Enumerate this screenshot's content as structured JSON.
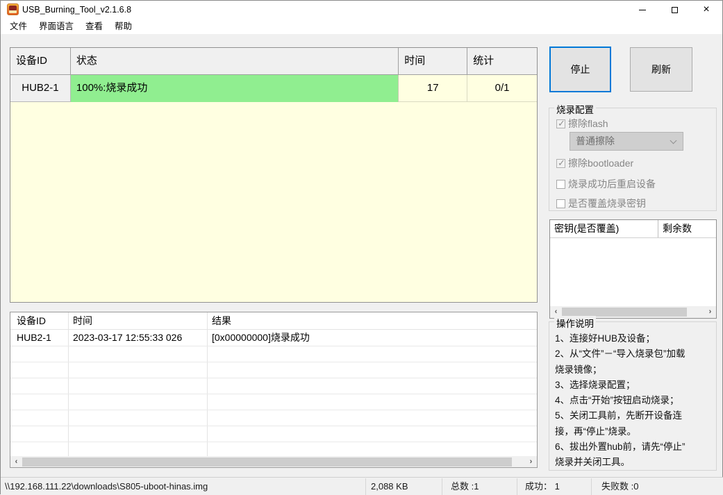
{
  "window": {
    "title": "USB_Burning_Tool_v2.1.6.8"
  },
  "menu": {
    "items": [
      "文件",
      "界面语言",
      "查看",
      "帮助"
    ]
  },
  "device_table": {
    "headers": {
      "id": "设备ID",
      "status": "状态",
      "time": "时间",
      "stats": "统计"
    },
    "row": {
      "id": "HUB2-1",
      "status": "100%:烧录成功",
      "time": "17",
      "stats": "0/1"
    }
  },
  "actions": {
    "stop": "停止",
    "refresh": "刷新"
  },
  "burn_config": {
    "title": "烧录配置",
    "erase_flash": {
      "label": "擦除flash",
      "checked": true
    },
    "erase_mode": {
      "value": "普通擦除"
    },
    "erase_bootloader": {
      "label": "擦除bootloader",
      "checked": true
    },
    "reboot_after": {
      "label": "烧录成功后重启设备",
      "checked": false
    },
    "overwrite_key": {
      "label": "是否覆盖烧录密钥",
      "checked": false
    }
  },
  "key_table": {
    "headers": {
      "key": "密钥(是否覆盖)",
      "remaining": "剩余数"
    }
  },
  "instructions": {
    "title": "操作说明",
    "lines": [
      "1、连接好HUB及设备；",
      "2、从“文件”－“导入烧录包”加载",
      "烧录镜像；",
      "3、选择烧录配置；",
      "4、点击“开始”按钮启动烧录；",
      "5、关闭工具前，先断开设备连",
      "接，再“停止”烧录。",
      "6、拔出外置hub前，请先“停止”",
      "烧录并关闭工具。"
    ]
  },
  "log_table": {
    "headers": {
      "id": "设备ID",
      "time": "时间",
      "result": "结果"
    },
    "rows": [
      {
        "id": "HUB2-1",
        "time": "2023-03-17 12:55:33 026",
        "result": "[0x00000000]烧录成功"
      }
    ]
  },
  "status_bar": {
    "path": "\\\\192.168.111.22\\downloads\\S805-uboot-hinas.img",
    "size": "2,088 KB",
    "total": "总数 :1",
    "success": "成功： 1",
    "failed": "失败数 :0"
  },
  "colors": {
    "accent": "#0078d7",
    "success_green": "#90ee90",
    "row_cream": "#ffffe1"
  }
}
